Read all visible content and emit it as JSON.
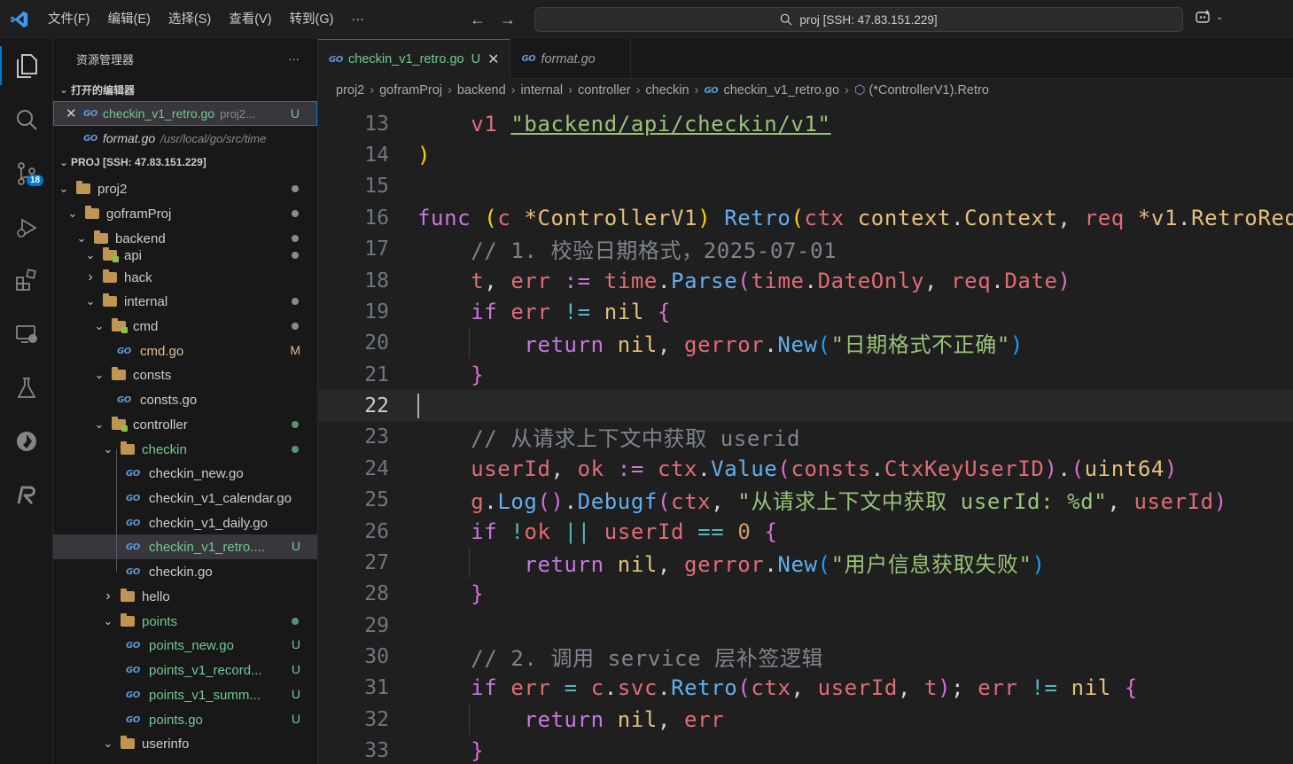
{
  "titlebar": {
    "menus": [
      "文件(F)",
      "编辑(E)",
      "选择(S)",
      "查看(V)",
      "转到(G)",
      "···"
    ],
    "search_text": "proj [SSH: 47.83.151.229]"
  },
  "activity": {
    "scm_badge": "18"
  },
  "sidebar": {
    "title": "资源管理器",
    "more": "···",
    "open_editors_label": "打开的编辑器",
    "open_editors": [
      {
        "name": "checkin_v1_retro.go",
        "path": "proj2...",
        "status": "U"
      },
      {
        "name": "format.go",
        "path": "/usr/local/go/src/time",
        "status": ""
      }
    ],
    "project_label": "PROJ [SSH: 47.83.151.229]",
    "tree": [
      {
        "label": "proj2",
        "status": ""
      },
      {
        "label": "goframProj",
        "status": ""
      },
      {
        "label": "backend",
        "status": ""
      },
      {
        "label": "api",
        "status": ""
      },
      {
        "label": "hack",
        "status": ""
      },
      {
        "label": "internal",
        "status": ""
      },
      {
        "label": "cmd",
        "status": ""
      },
      {
        "label": "cmd.go",
        "status": "M"
      },
      {
        "label": "consts",
        "status": ""
      },
      {
        "label": "consts.go",
        "status": ""
      },
      {
        "label": "controller",
        "status": ""
      },
      {
        "label": "checkin",
        "status": ""
      },
      {
        "label": "checkin_new.go",
        "status": ""
      },
      {
        "label": "checkin_v1_calendar.go",
        "status": ""
      },
      {
        "label": "checkin_v1_daily.go",
        "status": ""
      },
      {
        "label": "checkin_v1_retro....",
        "status": "U"
      },
      {
        "label": "checkin.go",
        "status": ""
      },
      {
        "label": "hello",
        "status": ""
      },
      {
        "label": "points",
        "status": ""
      },
      {
        "label": "points_new.go",
        "status": "U"
      },
      {
        "label": "points_v1_record...",
        "status": "U"
      },
      {
        "label": "points_v1_summ...",
        "status": "U"
      },
      {
        "label": "points.go",
        "status": "U"
      },
      {
        "label": "userinfo",
        "status": ""
      }
    ]
  },
  "tabs": [
    {
      "label": "checkin_v1_retro.go",
      "status": "U",
      "close": "✕"
    },
    {
      "label": "format.go"
    }
  ],
  "breadcrumb": [
    "proj2",
    "goframProj",
    "backend",
    "internal",
    "controller",
    "checkin",
    "checkin_v1_retro.go",
    "(*ControllerV1).Retro"
  ],
  "editor": {
    "current_line": "22",
    "line_numbers": [
      "13",
      "14",
      "15",
      "16",
      "17",
      "18",
      "19",
      "20",
      "21",
      "22",
      "23",
      "24",
      "25",
      "26",
      "27",
      "28",
      "29",
      "30",
      "31",
      "32",
      "33"
    ],
    "strings": {
      "import_path": "\"backend/api/checkin/v1\"",
      "comment1": "// 1. 校验日期格式，2025-07-01",
      "err_date": "\"日期格式不正确\"",
      "comment2": "// 从请求上下文中获取 userid",
      "debug_msg": "\"从请求上下文中获取 userId: %d\"",
      "err_user": "\"用户信息获取失败\"",
      "comment3": "// 2. 调用 service 层补签逻辑",
      "zero": "0"
    }
  }
}
